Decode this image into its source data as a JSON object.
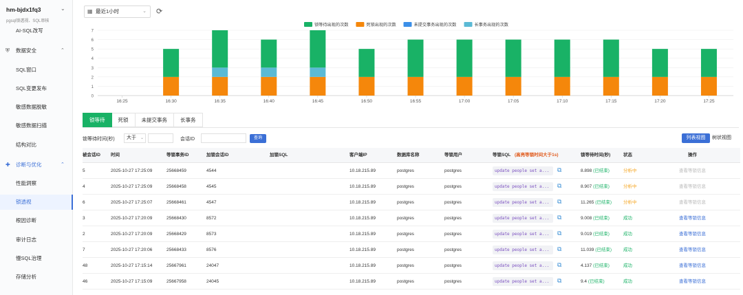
{
  "sidebar": {
    "instance_title": "hm-bjdx1fq3",
    "instance_sub": "pgsql锁透视、SQL审核",
    "items": [
      {
        "type": "item",
        "label": "AI-SQL改写"
      },
      {
        "type": "group",
        "label": "数据安全",
        "icon": "shield-icon"
      },
      {
        "type": "item",
        "label": "SQL窗口"
      },
      {
        "type": "item",
        "label": "SQL变更发布"
      },
      {
        "type": "item",
        "label": "敏感数据脱敏"
      },
      {
        "type": "item",
        "label": "敏感数据扫描"
      },
      {
        "type": "item",
        "label": "结构对比"
      },
      {
        "type": "group",
        "label": "诊断与优化",
        "icon": "stethoscope-icon"
      },
      {
        "type": "item",
        "label": "性能洞察"
      },
      {
        "type": "item",
        "label": "锁透视",
        "active": true
      },
      {
        "type": "item",
        "label": "根因诊断"
      },
      {
        "type": "item",
        "label": "审计日志"
      },
      {
        "type": "item",
        "label": "慢SQL治理"
      },
      {
        "type": "item",
        "label": "存储分析"
      }
    ]
  },
  "toolbar": {
    "time_range": "最近1小时"
  },
  "chart_data": {
    "type": "bar",
    "stacked": true,
    "categories": [
      "16:25",
      "16:30",
      "16:35",
      "16:40",
      "16:45",
      "16:50",
      "16:55",
      "17:00",
      "17:05",
      "17:10",
      "17:15",
      "17:20",
      "17:25"
    ],
    "series": [
      {
        "name": "锁等待出现的次数",
        "color": "#19b266",
        "values": [
          0,
          3,
          4,
          3,
          4,
          3,
          4,
          4,
          4,
          4,
          4,
          3,
          3
        ]
      },
      {
        "name": "死锁出现的次数",
        "color": "#f5870b",
        "values": [
          0,
          2,
          2,
          2,
          2,
          2,
          2,
          2,
          2,
          2,
          2,
          2,
          2
        ]
      },
      {
        "name": "未提交事务出现的次数",
        "color": "#3b8fe8",
        "values": [
          0,
          0,
          0,
          0,
          0,
          0,
          0,
          0,
          0,
          0,
          0,
          0,
          0
        ]
      },
      {
        "name": "长事务出现的次数",
        "color": "#5bbad5",
        "values": [
          0,
          0,
          1,
          1,
          1,
          0,
          0,
          0,
          0,
          0,
          0,
          0,
          0
        ]
      }
    ],
    "yticks": [
      0,
      1,
      2,
      3,
      4,
      5,
      6,
      7
    ],
    "ylim": [
      0,
      7
    ],
    "legend": "top-center",
    "grid": true
  },
  "tabs": [
    "锁等待",
    "死锁",
    "未提交事务",
    "长事务"
  ],
  "active_tab": 0,
  "filter": {
    "wait_label": "锁等待时间(秒)",
    "op": "大于",
    "session_label": "会话ID",
    "query_label": "查询"
  },
  "views": {
    "list": "列表视图",
    "tree": "树状视图"
  },
  "table": {
    "headers": [
      "被会话ID",
      "时间",
      "等锁事务ID",
      "加锁会话ID",
      "加锁SQL",
      "客户端IP",
      "数据库名称",
      "等锁用户",
      "等锁SQL",
      "(高亮等锁时间大于1s)",
      "锁等待时间(秒)",
      "状态",
      "操作"
    ],
    "rows": [
      {
        "sid": "5",
        "time": "2025-10-27 17:25:09",
        "txid": "25668459",
        "lock_sid": "4544",
        "ip": "10.18.215.89",
        "db": "postgres",
        "user": "postgres",
        "sql": "update people set a...",
        "wait": "8.898",
        "wait_state": "(已结束)",
        "status": "分析中",
        "status_type": "running",
        "action": "查看等锁信息",
        "action_enabled": false
      },
      {
        "sid": "4",
        "time": "2025-10-27 17:25:09",
        "txid": "25668458",
        "lock_sid": "4545",
        "ip": "10.18.215.89",
        "db": "postgres",
        "user": "postgres",
        "sql": "update people set a...",
        "wait": "8.907",
        "wait_state": "(已结束)",
        "status": "分析中",
        "status_type": "running",
        "action": "查看等锁信息",
        "action_enabled": false
      },
      {
        "sid": "6",
        "time": "2025-10-27 17:25:07",
        "txid": "25668461",
        "lock_sid": "4547",
        "ip": "10.18.215.89",
        "db": "postgres",
        "user": "postgres",
        "sql": "update people set a...",
        "wait": "11.265",
        "wait_state": "(已结束)",
        "status": "分析中",
        "status_type": "running",
        "action": "查看等锁信息",
        "action_enabled": false
      },
      {
        "sid": "3",
        "time": "2025-10-27 17:20:09",
        "txid": "25668430",
        "lock_sid": "8572",
        "ip": "10.18.215.89",
        "db": "postgres",
        "user": "postgres",
        "sql": "update people set a...",
        "wait": "9.008",
        "wait_state": "(已结束)",
        "status": "成功",
        "status_type": "success",
        "action": "查看等锁信息",
        "action_enabled": true
      },
      {
        "sid": "2",
        "time": "2025-10-27 17:20:09",
        "txid": "25668429",
        "lock_sid": "8573",
        "ip": "10.18.215.89",
        "db": "postgres",
        "user": "postgres",
        "sql": "update people set a...",
        "wait": "9.019",
        "wait_state": "(已结束)",
        "status": "成功",
        "status_type": "success",
        "action": "查看等锁信息",
        "action_enabled": true
      },
      {
        "sid": "7",
        "time": "2025-10-27 17:20:06",
        "txid": "25668433",
        "lock_sid": "8576",
        "ip": "10.18.215.89",
        "db": "postgres",
        "user": "postgres",
        "sql": "update people set a...",
        "wait": "11.039",
        "wait_state": "(已结束)",
        "status": "成功",
        "status_type": "success",
        "action": "查看等锁信息",
        "action_enabled": true
      },
      {
        "sid": "48",
        "time": "2025-10-27 17:15:14",
        "txid": "25667961",
        "lock_sid": "24047",
        "ip": "10.18.215.89",
        "db": "postgres",
        "user": "postgres",
        "sql": "update people set a...",
        "wait": "4.137",
        "wait_state": "(已结束)",
        "status": "成功",
        "status_type": "success",
        "action": "查看等锁信息",
        "action_enabled": true
      },
      {
        "sid": "46",
        "time": "2025-10-27 17:15:09",
        "txid": "25667958",
        "lock_sid": "24045",
        "ip": "10.18.215.89",
        "db": "postgres",
        "user": "postgres",
        "sql": "update people set a...",
        "wait": "9.4",
        "wait_state": "(已结束)",
        "status": "成功",
        "status_type": "success",
        "action": "查看等锁信息",
        "action_enabled": true
      }
    ]
  }
}
